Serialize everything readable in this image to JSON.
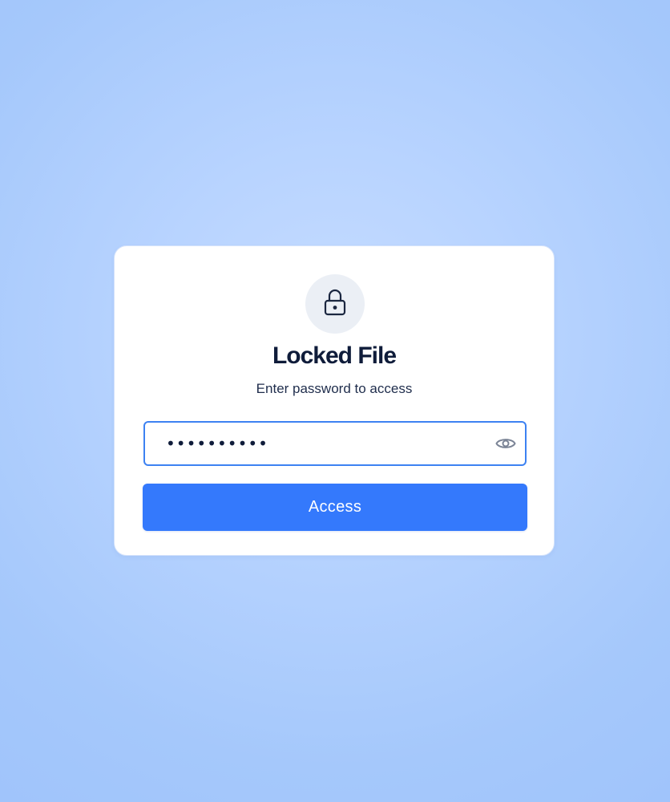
{
  "dialog": {
    "title": "Locked File",
    "subtitle": "Enter password to access",
    "lock_icon": "lock-icon",
    "password": {
      "value": "••••••••••",
      "type": "password",
      "toggle_icon": "eye-icon"
    },
    "submit_label": "Access"
  },
  "colors": {
    "accent": "#3479fc",
    "field_border": "#3d82f2",
    "title_text": "#0f1c3a",
    "background": "#b7d3ff"
  }
}
